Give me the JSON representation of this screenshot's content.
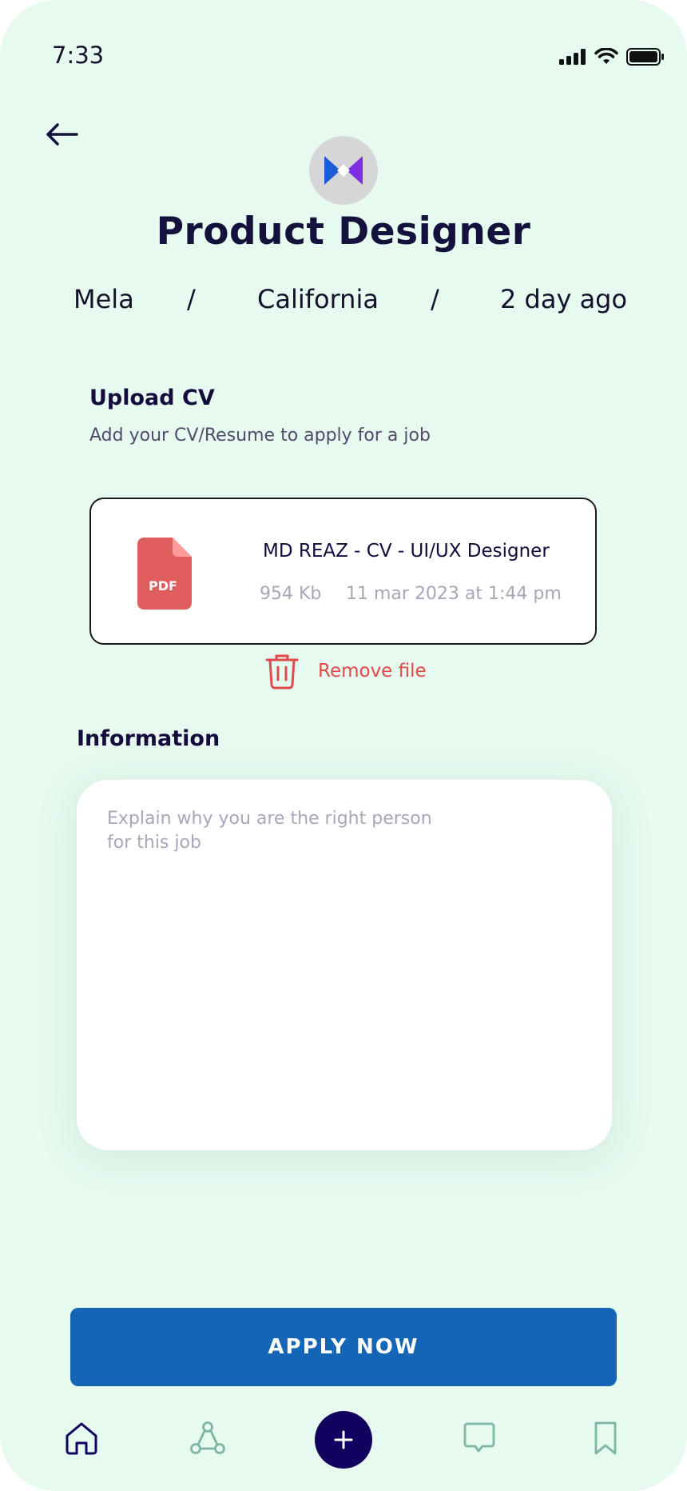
{
  "status_bar": {
    "time": "7:33",
    "icons": [
      "signal-icon",
      "wifi-icon",
      "battery-icon"
    ]
  },
  "header": {
    "back_icon": "back-arrow-icon",
    "logo_icon": "company-logo-icon",
    "title": "Product Designer",
    "meta": {
      "company": "Mela",
      "separator": "/",
      "location": "California",
      "posted": "2 day ago"
    }
  },
  "upload": {
    "title": "Upload CV",
    "subtitle": "Add your CV/Resume to apply for a job",
    "file": {
      "icon_label": "PDF",
      "name": "MD REAZ - CV - UI/UX Designer",
      "size": "954 Kb",
      "date": "11 mar 2023 at 1:44 pm"
    },
    "remove_label": "Remove file"
  },
  "information": {
    "title": "Information",
    "placeholder": "Explain why you are the right person\nfor this job",
    "value": ""
  },
  "apply_label": "APPLY NOW",
  "bottom_nav": {
    "items": [
      "home-icon",
      "connections-icon",
      "add-icon",
      "chat-icon",
      "bookmark-icon"
    ]
  },
  "colors": {
    "background": "#e6faf0",
    "primary": "#1565b6",
    "title": "#14123d",
    "remove": "#e04a4a",
    "pdf": "#e05d5d",
    "nav_active": "#130160",
    "nav_inactive": "#7fb5a5"
  }
}
